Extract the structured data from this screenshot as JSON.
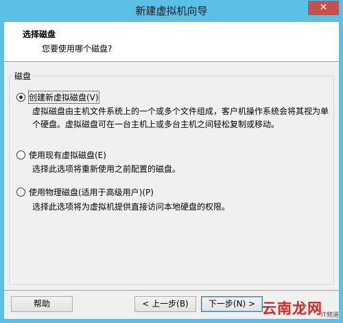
{
  "window": {
    "title": "新建虚拟机向导",
    "close_glyph": "✕"
  },
  "header": {
    "title": "选择磁盘",
    "subtitle": "您要使用哪个磁盘?"
  },
  "group": {
    "legend": "磁盘"
  },
  "options": [
    {
      "label": "创建新虚拟磁盘(V)",
      "selected": true,
      "description": "虚拟磁盘由主机文件系统上的一个或多个文件组成，客户机操作系统会将其视为单个硬盘。虚拟磁盘可在一台主机上或多台主机之间轻松复制或移动。"
    },
    {
      "label": "使用现有虚拟磁盘(E)",
      "selected": false,
      "description": "选择此选项将重新使用之前配置的磁盘。"
    },
    {
      "label": "使用物理磁盘(适用于高级用户)(P)",
      "selected": false,
      "description": "选择此选项将为虚拟机提供直接访问本地硬盘的权限。"
    }
  ],
  "buttons": {
    "help": "帮助",
    "back": "< 上一步(B)",
    "next": "下一步(N) >"
  },
  "watermark": {
    "text": "云南龙网",
    "sub": "IT频道"
  },
  "colors": {
    "titlebar": "#5cbfe6",
    "close_button": "#c7504b",
    "watermark": "#d9251d"
  }
}
